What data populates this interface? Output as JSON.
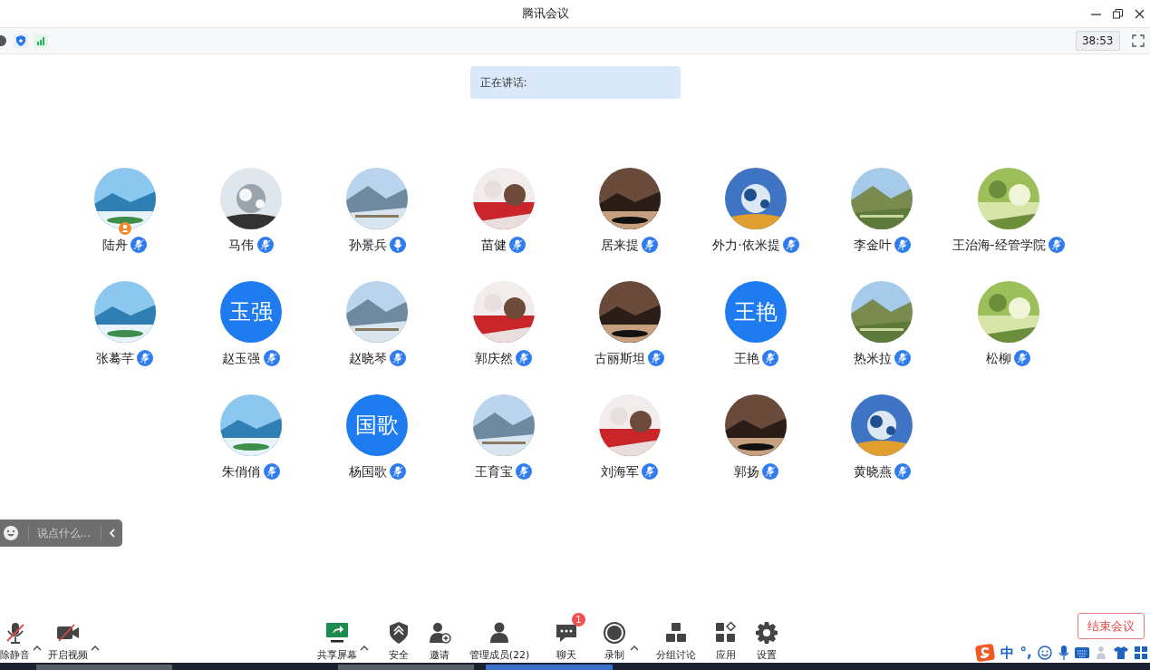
{
  "window": {
    "title": "腾讯会议"
  },
  "timer": "38:53",
  "speaking": {
    "label": "正在讲话:"
  },
  "participants": [
    [
      {
        "name": "陆舟",
        "muted": true,
        "host": true
      },
      {
        "name": "马伟",
        "muted": true,
        "host": false
      },
      {
        "name": "孙景兵",
        "muted": false,
        "host": false
      },
      {
        "name": "苗健",
        "muted": true,
        "host": false
      },
      {
        "name": "居来提",
        "muted": true,
        "host": false
      },
      {
        "name": "外力·依米提",
        "muted": true,
        "host": false
      },
      {
        "name": "李金叶",
        "muted": true,
        "host": false
      },
      {
        "name": "王治海-经管学院",
        "muted": true,
        "host": false
      }
    ],
    [
      {
        "name": "张蓦芊",
        "muted": true,
        "host": false
      },
      {
        "name": "赵玉强",
        "avatar": {
          "kind": "text",
          "text": "玉强"
        },
        "muted": true,
        "host": false
      },
      {
        "name": "赵晓琴",
        "muted": true,
        "host": false
      },
      {
        "name": "郭庆然",
        "muted": true,
        "host": false
      },
      {
        "name": "古丽斯坦",
        "muted": true,
        "host": false
      },
      {
        "name": "王艳",
        "avatar": {
          "kind": "text",
          "text": "王艳"
        },
        "muted": true,
        "host": false
      },
      {
        "name": "热米拉",
        "muted": true,
        "host": false
      },
      {
        "name": "松柳",
        "muted": true,
        "host": false
      }
    ],
    [
      {
        "name": "朱俏俏",
        "muted": true,
        "host": false
      },
      {
        "name": "杨国歌",
        "avatar": {
          "kind": "text",
          "text": "国歌"
        },
        "muted": true,
        "host": false
      },
      {
        "name": "王育宝",
        "muted": true,
        "host": false
      },
      {
        "name": "刘海军",
        "muted": true,
        "host": false
      },
      {
        "name": "郭扬",
        "muted": true,
        "host": false
      },
      {
        "name": "黄晓燕",
        "muted": true,
        "host": false
      }
    ]
  ],
  "chat_input": {
    "placeholder": "说点什么..."
  },
  "toolbar_left": [
    {
      "kind": "mic",
      "label": "除静音",
      "caret": true
    },
    {
      "kind": "video",
      "label": "开启视频",
      "caret": true
    }
  ],
  "toolbar": [
    {
      "kind": "share",
      "label": "共享屏幕",
      "caret": true
    },
    {
      "kind": "security",
      "label": "安全",
      "caret": false
    },
    {
      "kind": "invite",
      "label": "邀请",
      "caret": false
    },
    {
      "kind": "members",
      "label": "管理成员(22)",
      "caret": false
    },
    {
      "kind": "chat",
      "label": "聊天",
      "caret": false,
      "badge": "1"
    },
    {
      "kind": "record",
      "label": "录制",
      "caret": true
    },
    {
      "kind": "breakout",
      "label": "分组讨论",
      "caret": false
    },
    {
      "kind": "apps",
      "label": "应用",
      "caret": false
    },
    {
      "kind": "settings",
      "label": "设置",
      "caret": false
    }
  ],
  "end_button": {
    "label": "结束会议"
  },
  "ime_bar": {
    "mode": "中",
    "punct": "°,"
  }
}
